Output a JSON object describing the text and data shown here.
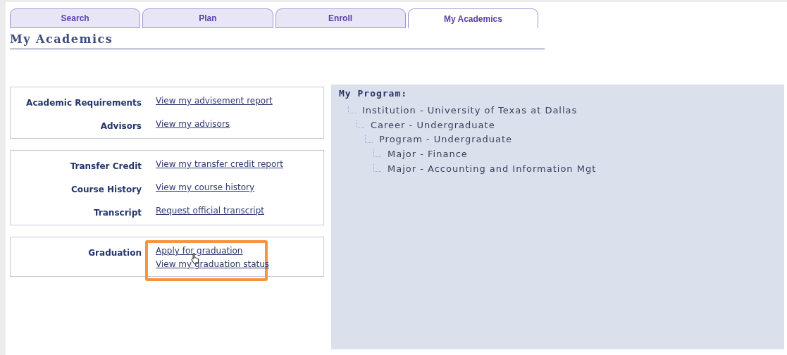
{
  "tabs": [
    {
      "label": "Search",
      "selected": false
    },
    {
      "label": "Plan",
      "selected": false
    },
    {
      "label": "Enroll",
      "selected": false
    },
    {
      "label": "My Academics",
      "selected": true
    }
  ],
  "page_title": "My Academics",
  "sections": [
    {
      "highlighted": false,
      "rows": [
        {
          "label": "Academic Requirements",
          "links": [
            {
              "text": "View my advisement report",
              "hovered": false
            }
          ]
        },
        {
          "label": "Advisors",
          "links": [
            {
              "text": "View my advisors",
              "hovered": false
            }
          ]
        }
      ]
    },
    {
      "highlighted": false,
      "rows": [
        {
          "label": "Transfer Credit",
          "links": [
            {
              "text": "View my transfer credit report",
              "hovered": false
            }
          ]
        },
        {
          "label": "Course History",
          "links": [
            {
              "text": "View my course history",
              "hovered": false
            }
          ]
        },
        {
          "label": "Transcript",
          "links": [
            {
              "text": "Request official transcript",
              "hovered": false
            }
          ]
        }
      ]
    },
    {
      "highlighted": true,
      "rows": [
        {
          "label": "Graduation",
          "links": [
            {
              "text": "Apply for graduation",
              "hovered": true
            },
            {
              "text": "View my graduation status",
              "hovered": false
            }
          ]
        }
      ]
    }
  ],
  "program": {
    "title": "My Program:",
    "tree": [
      {
        "text": "Institution - University of Texas at Dallas",
        "children": [
          {
            "text": "Career - Undergraduate",
            "children": [
              {
                "text": "Program - Undergraduate",
                "children": [
                  {
                    "text": "Major - Finance"
                  },
                  {
                    "text": "Major - Accounting and Information Mgt"
                  }
                ]
              }
            ]
          }
        ]
      }
    ]
  }
}
